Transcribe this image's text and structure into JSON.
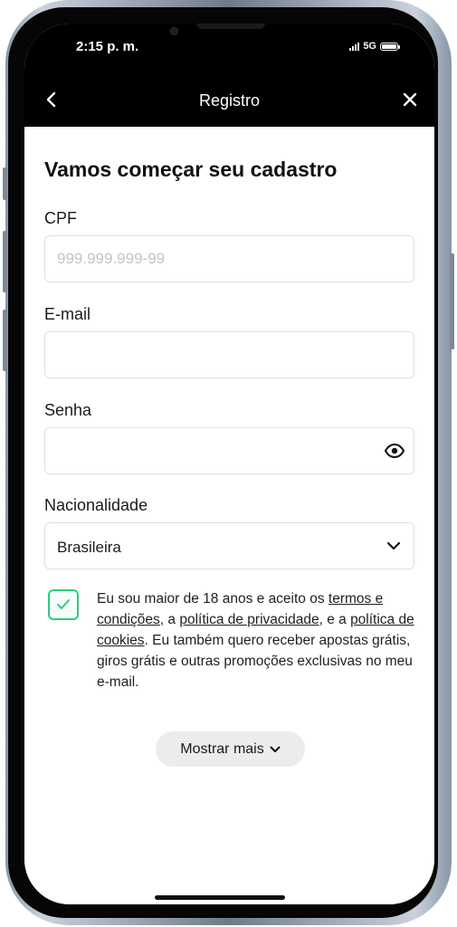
{
  "status_bar": {
    "time": "2:15 p. m.",
    "network": "5G"
  },
  "nav": {
    "title": "Registro"
  },
  "page": {
    "title": "Vamos começar seu cadastro"
  },
  "form": {
    "cpf": {
      "label": "CPF",
      "placeholder": "999.999.999-99",
      "value": ""
    },
    "email": {
      "label": "E-mail",
      "value": ""
    },
    "password": {
      "label": "Senha",
      "value": ""
    },
    "nationality": {
      "label": "Nacionalidade",
      "selected": "Brasileira"
    }
  },
  "consent": {
    "checked": true,
    "text_1": "Eu sou maior de 18 anos e aceito os ",
    "link_terms": "termos e condições",
    "text_2": ", a ",
    "link_privacy": "política de privacidade",
    "text_3": ", e a ",
    "link_cookies": "política de cookies",
    "text_4": ". Eu também quero receber apostas grátis, giros grátis e outras promoções exclusivas no meu e-mail."
  },
  "show_more": {
    "label": "Mostrar mais"
  },
  "colors": {
    "accent": "#2fcb7f",
    "nav_bg": "#000000",
    "field_border": "#e1e1e1"
  }
}
